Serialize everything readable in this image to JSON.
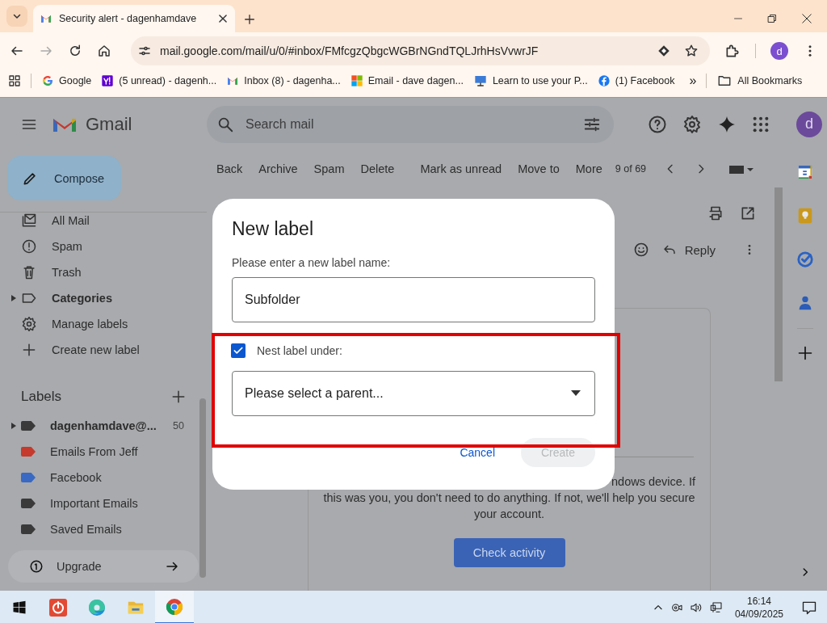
{
  "browser": {
    "tab": {
      "title": "Security alert - dagenhamdave"
    },
    "url": "mail.google.com/mail/u/0/#inbox/FMfcgzQbgcWGBrNGndTQLJrhHsVvwrJF",
    "profile_initial": "d",
    "bookmarks": [
      {
        "label": "Google",
        "kind": "google"
      },
      {
        "label": "(5 unread) - dagenh...",
        "kind": "yahoo"
      },
      {
        "label": "Inbox (8) - dagenha...",
        "kind": "gmail"
      },
      {
        "label": "Email - dave dagen...",
        "kind": "microsoft"
      },
      {
        "label": "Learn to use your P...",
        "kind": "monitor"
      },
      {
        "label": "(1) Facebook",
        "kind": "facebook"
      }
    ],
    "overflow": "»",
    "all_bookmarks": "All Bookmarks"
  },
  "gmail": {
    "logo_text": "Gmail",
    "search": {
      "placeholder": "Search mail"
    },
    "account_initial": "d",
    "compose": "Compose",
    "nav": [
      {
        "label": "All Mail",
        "kind": "allmail",
        "unread": false,
        "expandable": false
      },
      {
        "label": "Spam",
        "kind": "spam",
        "unread": false,
        "expandable": false
      },
      {
        "label": "Trash",
        "kind": "trash",
        "unread": false,
        "expandable": false
      },
      {
        "label": "Categories",
        "kind": "label",
        "unread": true,
        "expandable": true
      },
      {
        "label": "Manage labels",
        "kind": "gear",
        "unread": false,
        "expandable": false
      },
      {
        "label": "Create new label",
        "kind": "plus",
        "unread": false,
        "expandable": false
      }
    ],
    "labels_heading": "Labels",
    "labels": [
      {
        "label": "dagenhamdave@...",
        "count": "50",
        "color": "#3a3a3a",
        "unread": true,
        "expandable": true
      },
      {
        "label": "Emails From Jeff",
        "color": "#c53a2c",
        "unread": false,
        "expandable": false
      },
      {
        "label": "Facebook",
        "color": "#3a69c4",
        "unread": false,
        "expandable": false
      },
      {
        "label": "Important Emails",
        "color": "#3a3a3a",
        "unread": false,
        "expandable": false
      },
      {
        "label": "Saved Emails",
        "color": "#3a3a3a",
        "unread": false,
        "expandable": false
      }
    ],
    "upgrade": "Upgrade",
    "actions": [
      "Back",
      "Archive",
      "Spam",
      "Delete",
      "Mark as unread",
      "Move to",
      "More"
    ],
    "pager": "9 of 69",
    "reply": "Reply",
    "message": {
      "lines": [
        "ndows device. If",
        "this was you, you don't need to do anything. If not, we'll help you secure",
        "your account."
      ],
      "button": "Check activity"
    }
  },
  "dialog": {
    "title": "New label",
    "prompt": "Please enter a new label name:",
    "name_value": "Subfolder",
    "nest": {
      "label": "Nest label under:",
      "checked": true
    },
    "parent_select": {
      "value": "Please select a parent..."
    },
    "buttons": [
      {
        "label": "Cancel",
        "disabled": false
      },
      {
        "label": "Create",
        "disabled": true
      }
    ]
  },
  "taskbar": {
    "time": "16:14",
    "date": "04/09/2025"
  }
}
